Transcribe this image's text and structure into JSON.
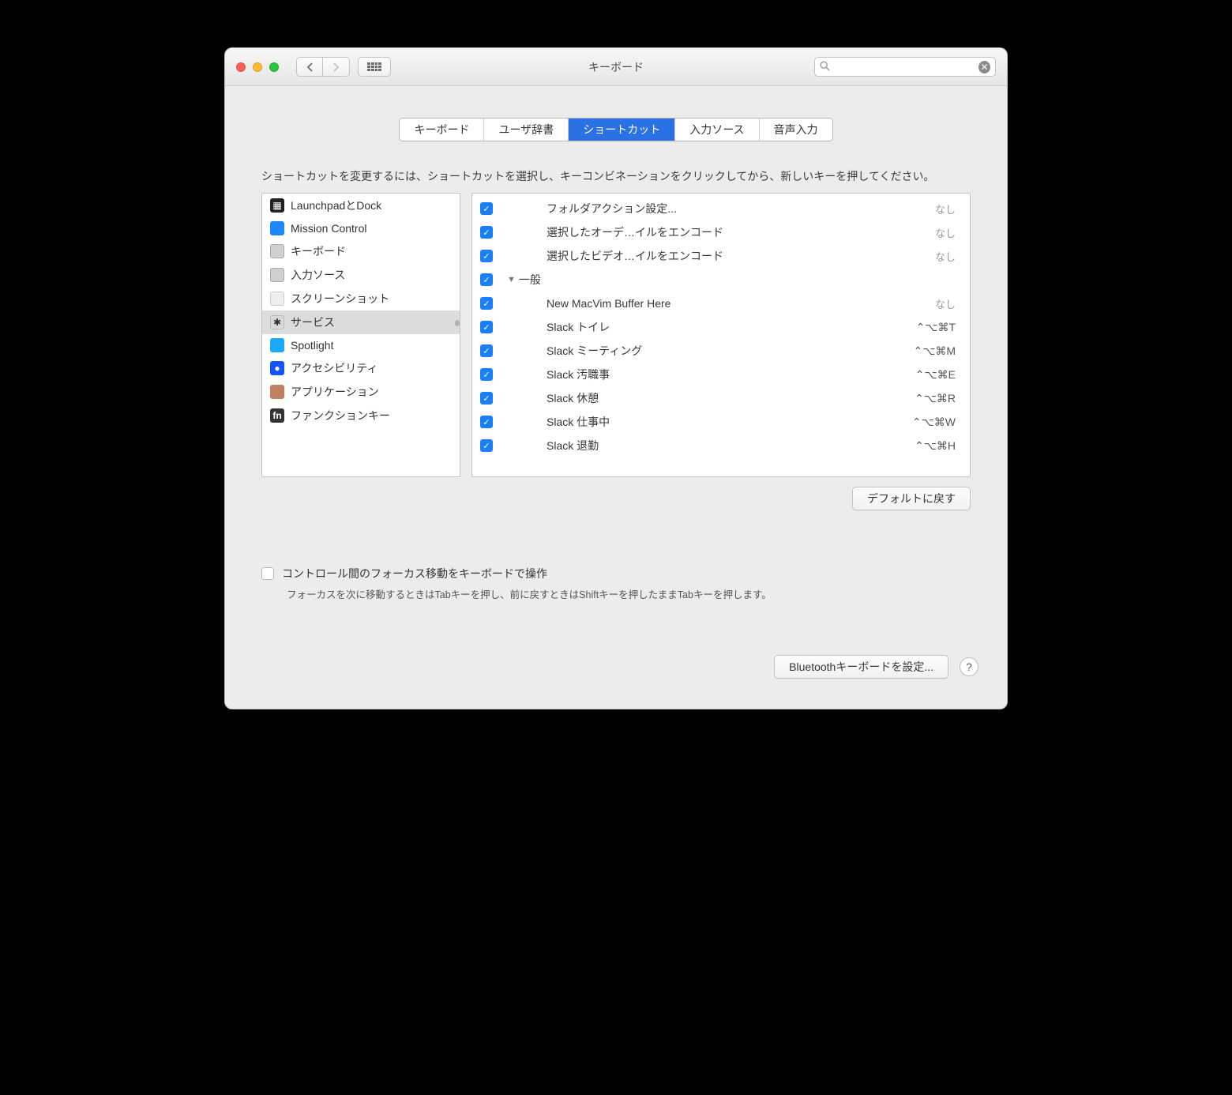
{
  "header": {
    "title": "キーボード",
    "search_placeholder": ""
  },
  "tabs": [
    {
      "label": "キーボード"
    },
    {
      "label": "ユーザ辞書"
    },
    {
      "label": "ショートカット",
      "active": true
    },
    {
      "label": "入力ソース"
    },
    {
      "label": "音声入力"
    }
  ],
  "instruction": "ショートカットを変更するには、ショートカットを選択し、キーコンビネーションをクリックしてから、新しいキーを押してください。",
  "sidebar": [
    {
      "label": "LaunchpadとDock",
      "icon": "launchpad"
    },
    {
      "label": "Mission Control",
      "icon": "mission"
    },
    {
      "label": "キーボード",
      "icon": "kb"
    },
    {
      "label": "入力ソース",
      "icon": "input"
    },
    {
      "label": "スクリーンショット",
      "icon": "screenshot"
    },
    {
      "label": "サービス",
      "icon": "services",
      "selected": true
    },
    {
      "label": "Spotlight",
      "icon": "spotlight"
    },
    {
      "label": "アクセシビリティ",
      "icon": "a11y"
    },
    {
      "label": "アプリケーション",
      "icon": "app"
    },
    {
      "label": "ファンクションキー",
      "icon": "fn"
    }
  ],
  "shortcuts": {
    "pre": [
      {
        "label": "フォルダアクション設定...",
        "shortcut": "なし",
        "none": true
      },
      {
        "label": "選択したオーデ…イルをエンコード",
        "shortcut": "なし",
        "none": true
      },
      {
        "label": "選択したビデオ…イルをエンコード",
        "shortcut": "なし",
        "none": true
      }
    ],
    "group_label": "一般",
    "items": [
      {
        "label": "New MacVim Buffer Here",
        "shortcut": "なし",
        "none": true
      },
      {
        "label": "Slack トイレ",
        "shortcut": "⌃⌥⌘T"
      },
      {
        "label": "Slack ミーティング",
        "shortcut": "⌃⌥⌘M"
      },
      {
        "label": "Slack 汚職事",
        "shortcut": "⌃⌥⌘E"
      },
      {
        "label": "Slack 休憩",
        "shortcut": "⌃⌥⌘R"
      },
      {
        "label": "Slack 仕事中",
        "shortcut": "⌃⌥⌘W"
      },
      {
        "label": "Slack 退勤",
        "shortcut": "⌃⌥⌘H"
      }
    ]
  },
  "buttons": {
    "restore_defaults": "デフォルトに戻す",
    "bluetooth": "Bluetoothキーボードを設定..."
  },
  "focus_checkbox": {
    "label": "コントロール間のフォーカス移動をキーボードで操作",
    "hint": "フォーカスを次に移動するときはTabキーを押し、前に戻すときはShiftキーを押したままTabキーを押します。"
  }
}
